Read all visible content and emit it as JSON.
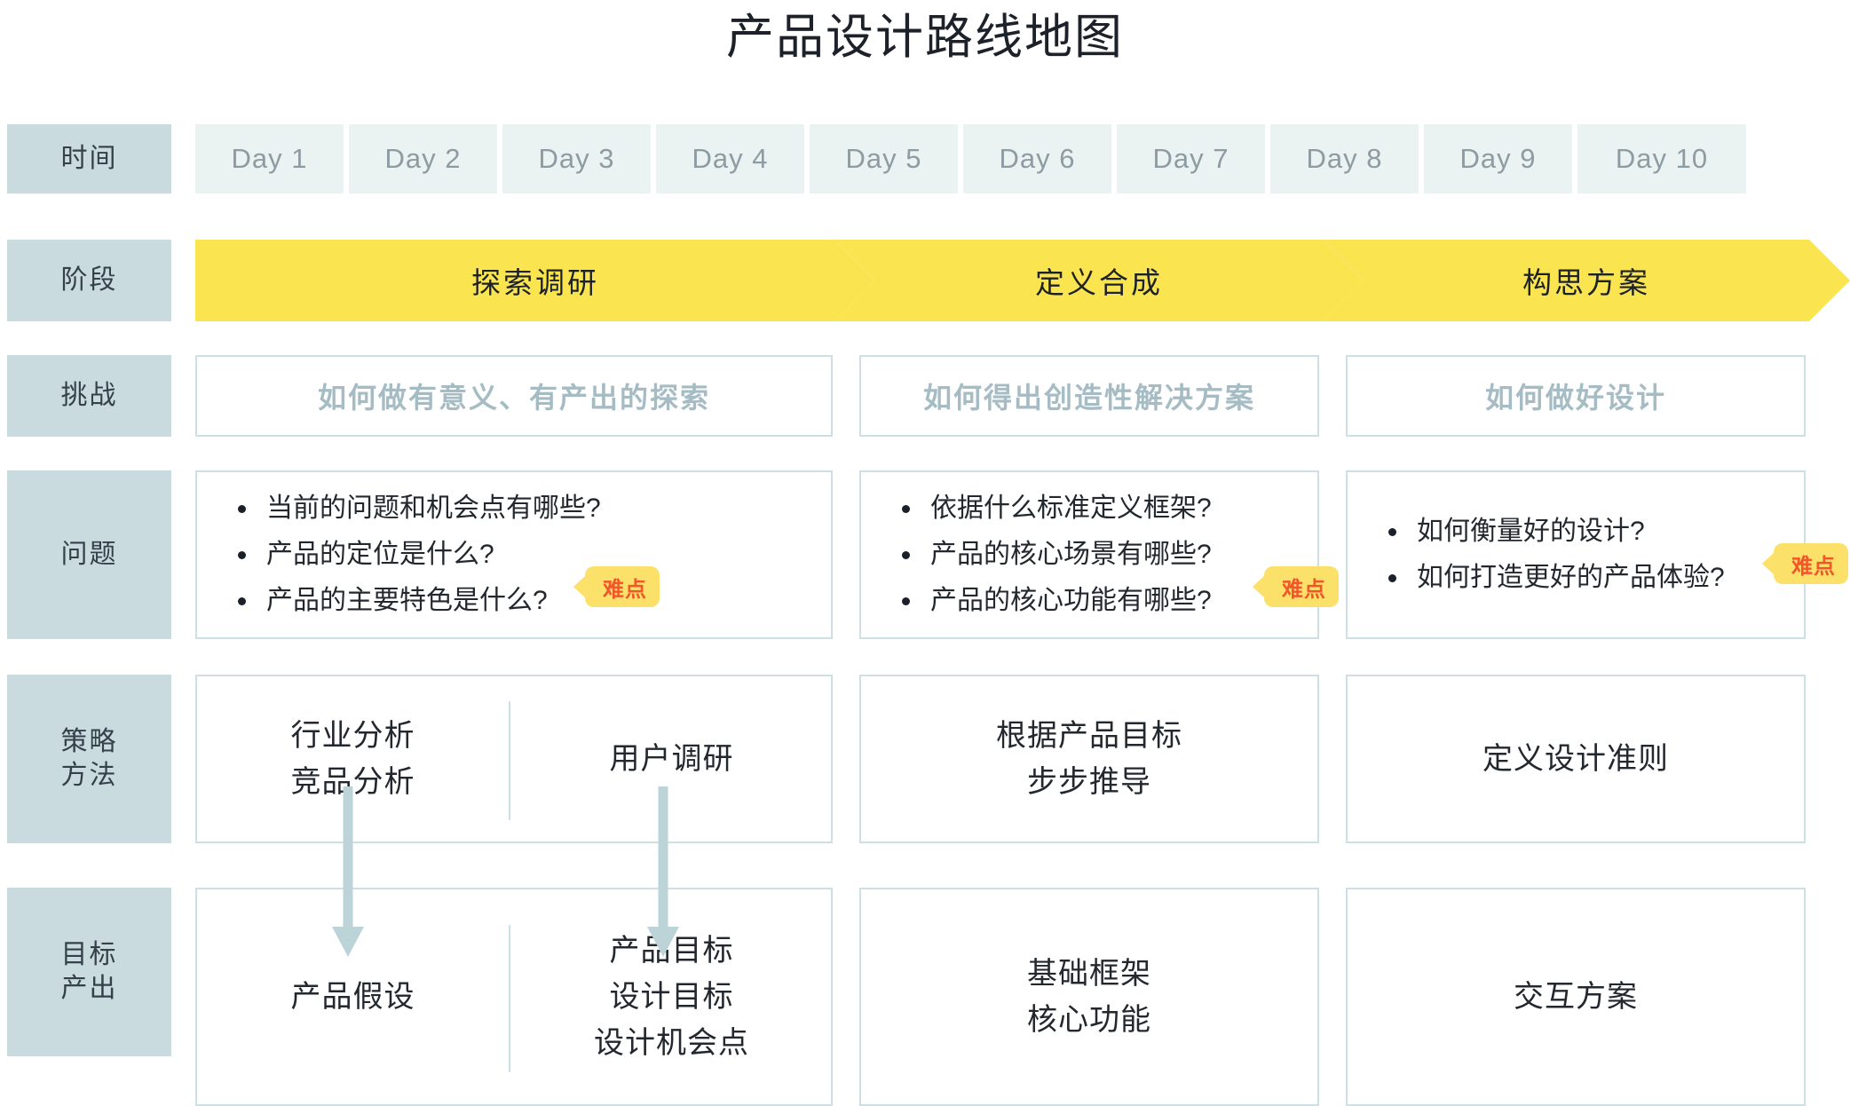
{
  "title": "产品设计路线地图",
  "row_labels": {
    "time": "时间",
    "phase": "阶段",
    "challenge": "挑战",
    "question": "问题",
    "method_line1": "策略",
    "method_line2": "方法",
    "output_line1": "目标",
    "output_line2": "产出"
  },
  "timeline": {
    "days": [
      "Day 1",
      "Day 2",
      "Day 3",
      "Day 4",
      "Day 5",
      "Day 6",
      "Day 7",
      "Day 8",
      "Day 9",
      "Day 10"
    ]
  },
  "phases": [
    {
      "label": "探索调研"
    },
    {
      "label": "定义合成"
    },
    {
      "label": "构思方案"
    }
  ],
  "challenges": [
    "如何做有意义、有产出的探索",
    "如何得出创造性解决方案",
    "如何做好设计"
  ],
  "questions": [
    {
      "items": [
        "当前的问题和机会点有哪些?",
        "产品的定位是什么?",
        "产品的主要特色是什么?"
      ],
      "badge": "难点"
    },
    {
      "items": [
        "依据什么标准定义框架?",
        "产品的核心场景有哪些?",
        "产品的核心功能有哪些?"
      ],
      "badge": "难点"
    },
    {
      "items": [
        "如何衡量好的设计?",
        "如何打造更好的产品体验?"
      ],
      "badge": "难点"
    }
  ],
  "methods": [
    {
      "cells": [
        "行业分析\n竞品分析",
        "用户调研"
      ]
    },
    {
      "cells": [
        "根据产品目标\n步步推导"
      ]
    },
    {
      "cells": [
        "定义设计准则"
      ]
    }
  ],
  "outputs": [
    {
      "cells": [
        "产品假设",
        "产品目标\n设计目标\n设计机会点"
      ]
    },
    {
      "cells": [
        "基础框架\n核心功能"
      ]
    },
    {
      "cells": [
        "交互方案"
      ]
    }
  ],
  "colors": {
    "label_bg": "#c9dbdf",
    "day_bg": "#eaf2f2",
    "phase_yellow": "#fae551",
    "card_border": "#cfe0e4",
    "challenge_text": "#a6bcc4",
    "badge_bg": "#fbe06a",
    "badge_text": "#f2562a",
    "arrow": "#bcd3d8"
  }
}
